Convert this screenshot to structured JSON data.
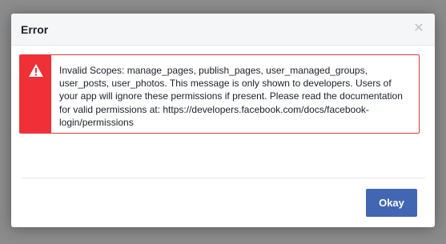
{
  "dialog": {
    "title": "Error",
    "close_icon": "close-icon",
    "error_message": "Invalid Scopes: manage_pages, publish_pages, user_managed_groups, user_posts, user_photos. This message is only shown to developers. Users of your app will ignore these permissions if present. Please read the documentation for valid permissions at: https://developers.facebook.com/docs/facebook-login/permissions",
    "warning_icon": "warning-icon",
    "okay_label": "Okay"
  },
  "colors": {
    "backdrop": "#8c8c8c",
    "header_bg": "#f5f6f7",
    "error_red": "#f02f36",
    "error_border": "#d93b3b",
    "button_blue": "#4267b2",
    "text_dark": "#1d2129"
  }
}
